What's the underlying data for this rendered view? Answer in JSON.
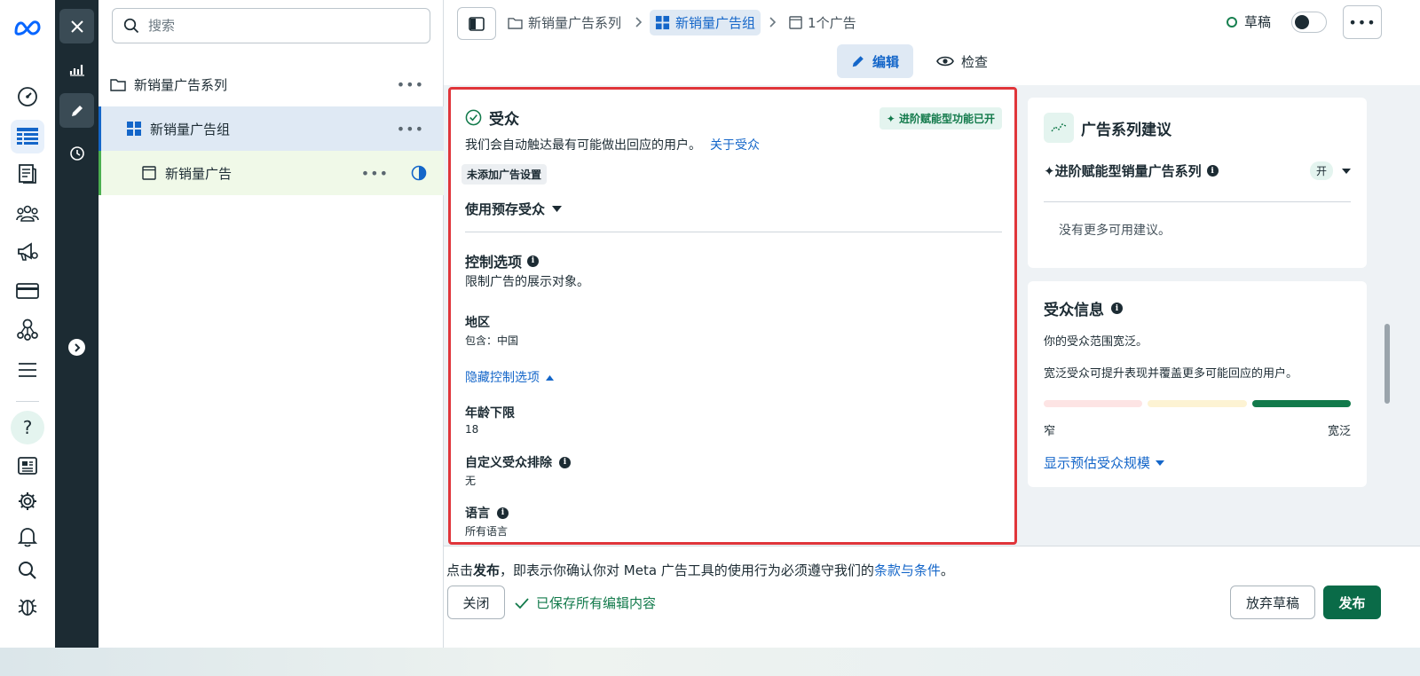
{
  "search": {
    "placeholder": "搜索"
  },
  "tree": {
    "campaign": "新销量广告系列",
    "adset": "新销量广告组",
    "ad": "新销量广告",
    "more": "•••"
  },
  "breadcrumb": {
    "campaign": "新销量广告系列",
    "adset": "新销量广告组",
    "ads": "1个广告"
  },
  "status": {
    "label": "草稿"
  },
  "more_label": "•••",
  "modes": {
    "edit": "编辑",
    "review": "检查"
  },
  "audience": {
    "title": "受众",
    "badge": "进阶赋能型功能已开",
    "description": "我们会自动触达最有可能做出回应的用户。",
    "about_link": "关于受众",
    "no_settings": "未添加广告设置",
    "saved_audience": "使用预存受众",
    "controls_title": "控制选项",
    "controls_desc": "限制广告的展示对象。",
    "region_label": "地区",
    "region_value": "包含：中国",
    "hide_controls": "隐藏控制选项",
    "min_age_label": "年龄下限",
    "min_age_value": "18",
    "exclusions_label": "自定义受众排除",
    "exclusions_value": "无",
    "language_label": "语言",
    "language_value": "所有语言"
  },
  "suggestions": {
    "title": "广告系列建议",
    "adv_label": "进阶赋能型销量广告系列",
    "adv_state": "开",
    "none": "没有更多可用建议。"
  },
  "audience_info": {
    "title": "受众信息",
    "line1": "你的受众范围宽泛。",
    "line2": "宽泛受众可提升表现并覆盖更多可能回应的用户。",
    "narrow": "窄",
    "broad": "宽泛",
    "show_size": "显示预估受众规模",
    "level": "broad"
  },
  "footer": {
    "legal_prefix": "点击",
    "legal_bold": "发布",
    "legal_middle": "，即表示你确认你对 Meta 广告工具的使用行为必须遵守我们的",
    "legal_link": "条款与条件",
    "legal_suffix": "。",
    "close": "关闭",
    "saved": "已保存所有编辑内容",
    "discard": "放弃草稿",
    "publish": "发布"
  },
  "colors": {
    "accent": "#1466c9",
    "publish": "#0a6b48",
    "highlight": "#e0353a"
  }
}
